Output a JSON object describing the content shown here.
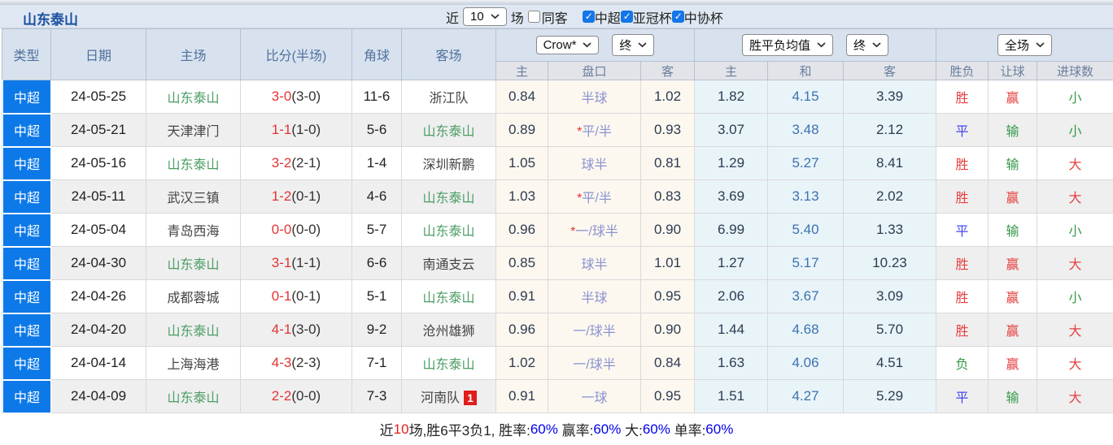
{
  "highlight_team": "山东泰山",
  "accent_colors": {
    "league_cell": "#0d79e8",
    "win_red": "#e54040",
    "draw_blue": "#4545ee",
    "lose_green": "#37994a",
    "taishan_green": "#4b9d63",
    "handicap_bg": "#fcf8f0",
    "odds_bg": "#e9f4f9"
  },
  "topbar": {
    "title": "山东泰山",
    "near_label": "近",
    "count_select": "10",
    "games_label": "场",
    "filters": [
      {
        "label": "同客",
        "checked": false
      },
      {
        "label": "中超",
        "checked": true
      },
      {
        "label": "亚冠杯",
        "checked": true
      },
      {
        "label": "中协杯",
        "checked": true
      }
    ]
  },
  "header": {
    "cols": [
      "类型",
      "日期",
      "主场",
      "比分(半场)",
      "角球",
      "客场"
    ],
    "group1": {
      "select1": "Crow*",
      "select2": "终",
      "sub": [
        "主",
        "盘口",
        "客"
      ]
    },
    "group2": {
      "select1": "胜平负均值",
      "select2": "终",
      "sub": [
        "主",
        "和",
        "客"
      ]
    },
    "group3": {
      "select1": "全场",
      "sub": [
        "胜负",
        "让球",
        "进球数"
      ]
    }
  },
  "rows": [
    {
      "type": "中超",
      "date": "24-05-25",
      "home": "山东泰山",
      "score": "3-0",
      "half": "(3-0)",
      "corner": "11-6",
      "away": "浙江队",
      "away_badge": "",
      "ah_home": "0.84",
      "ah_star": "",
      "ah_line": "半球",
      "ah_away": "1.02",
      "o_home": "1.82",
      "o_draw": "4.15",
      "o_away": "3.39",
      "res": "胜",
      "let": "赢",
      "goal": "小"
    },
    {
      "type": "中超",
      "date": "24-05-21",
      "home": "天津津门",
      "score": "1-1",
      "half": "(1-0)",
      "corner": "5-6",
      "away": "山东泰山",
      "away_badge": "",
      "ah_home": "0.89",
      "ah_star": "*",
      "ah_line": "平/半",
      "ah_away": "0.93",
      "o_home": "3.07",
      "o_draw": "3.48",
      "o_away": "2.12",
      "res": "平",
      "let": "输",
      "goal": "小"
    },
    {
      "type": "中超",
      "date": "24-05-16",
      "home": "山东泰山",
      "score": "3-2",
      "half": "(2-1)",
      "corner": "1-4",
      "away": "深圳新鹏",
      "away_badge": "",
      "ah_home": "1.05",
      "ah_star": "",
      "ah_line": "球半",
      "ah_away": "0.81",
      "o_home": "1.29",
      "o_draw": "5.27",
      "o_away": "8.41",
      "res": "胜",
      "let": "输",
      "goal": "大"
    },
    {
      "type": "中超",
      "date": "24-05-11",
      "home": "武汉三镇",
      "score": "1-2",
      "half": "(0-1)",
      "corner": "4-6",
      "away": "山东泰山",
      "away_badge": "",
      "ah_home": "1.03",
      "ah_star": "*",
      "ah_line": "平/半",
      "ah_away": "0.83",
      "o_home": "3.69",
      "o_draw": "3.13",
      "o_away": "2.02",
      "res": "胜",
      "let": "赢",
      "goal": "大"
    },
    {
      "type": "中超",
      "date": "24-05-04",
      "home": "青岛西海",
      "score": "0-0",
      "half": "(0-0)",
      "corner": "5-7",
      "away": "山东泰山",
      "away_badge": "",
      "ah_home": "0.96",
      "ah_star": "*",
      "ah_line": "一/球半",
      "ah_away": "0.90",
      "o_home": "6.99",
      "o_draw": "5.40",
      "o_away": "1.33",
      "res": "平",
      "let": "输",
      "goal": "小"
    },
    {
      "type": "中超",
      "date": "24-04-30",
      "home": "山东泰山",
      "score": "3-1",
      "half": "(1-1)",
      "corner": "6-6",
      "away": "南通支云",
      "away_badge": "",
      "ah_home": "0.85",
      "ah_star": "",
      "ah_line": "球半",
      "ah_away": "1.01",
      "o_home": "1.27",
      "o_draw": "5.17",
      "o_away": "10.23",
      "res": "胜",
      "let": "赢",
      "goal": "大"
    },
    {
      "type": "中超",
      "date": "24-04-26",
      "home": "成都蓉城",
      "score": "0-1",
      "half": "(0-1)",
      "corner": "5-1",
      "away": "山东泰山",
      "away_badge": "",
      "ah_home": "0.91",
      "ah_star": "",
      "ah_line": "半球",
      "ah_away": "0.95",
      "o_home": "2.06",
      "o_draw": "3.67",
      "o_away": "3.09",
      "res": "胜",
      "let": "赢",
      "goal": "小"
    },
    {
      "type": "中超",
      "date": "24-04-20",
      "home": "山东泰山",
      "score": "4-1",
      "half": "(3-0)",
      "corner": "9-2",
      "away": "沧州雄狮",
      "away_badge": "",
      "ah_home": "0.96",
      "ah_star": "",
      "ah_line": "一/球半",
      "ah_away": "0.90",
      "o_home": "1.44",
      "o_draw": "4.68",
      "o_away": "5.70",
      "res": "胜",
      "let": "赢",
      "goal": "大"
    },
    {
      "type": "中超",
      "date": "24-04-14",
      "home": "上海海港",
      "score": "4-3",
      "half": "(2-3)",
      "corner": "7-1",
      "away": "山东泰山",
      "away_badge": "",
      "ah_home": "1.02",
      "ah_star": "",
      "ah_line": "一/球半",
      "ah_away": "0.84",
      "o_home": "1.63",
      "o_draw": "4.06",
      "o_away": "4.51",
      "res": "负",
      "let": "赢",
      "goal": "大"
    },
    {
      "type": "中超",
      "date": "24-04-09",
      "home": "山东泰山",
      "score": "2-2",
      "half": "(0-0)",
      "corner": "7-3",
      "away": "河南队",
      "away_badge": "1",
      "ah_home": "0.91",
      "ah_star": "",
      "ah_line": "一球",
      "ah_away": "0.95",
      "o_home": "1.51",
      "o_draw": "4.27",
      "o_away": "5.29",
      "res": "平",
      "let": "输",
      "goal": "大"
    }
  ],
  "footer": {
    "parts": [
      "近",
      "10",
      "场,胜6平3负1, 胜率:",
      "60%",
      " 赢率:",
      "60%",
      " 大:",
      "60%",
      " 单率:",
      "60%"
    ]
  }
}
